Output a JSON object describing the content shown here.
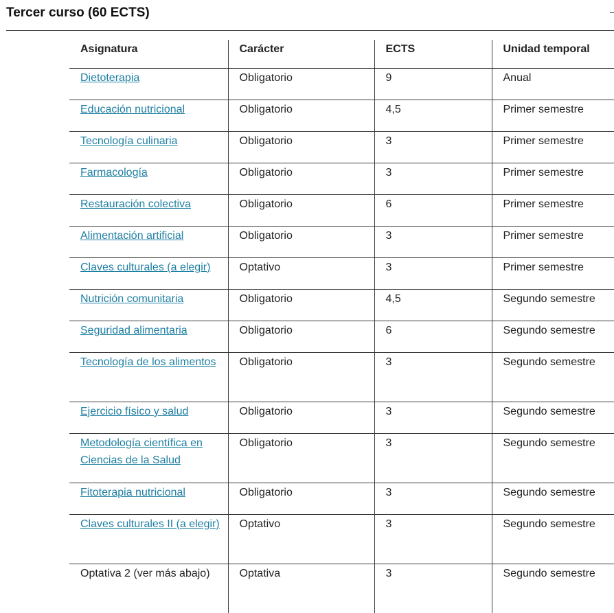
{
  "section": {
    "title": "Tercer curso (60 ECTS)"
  },
  "table": {
    "headers": [
      "Asignatura",
      "Carácter",
      "ECTS",
      "Unidad temporal"
    ],
    "rows": [
      {
        "subject": "Dietoterapia",
        "type": "Obligatorio",
        "ects": "9",
        "term": "Anual"
      },
      {
        "subject": "Educación nutricional",
        "type": "Obligatorio",
        "ects": "4,5",
        "term": "Primer semestre"
      },
      {
        "subject": "Tecnología culinaria",
        "type": "Obligatorio",
        "ects": "3",
        "term": "Primer semestre"
      },
      {
        "subject": "Farmacología",
        "type": "Obligatorio",
        "ects": "3",
        "term": "Primer semestre"
      },
      {
        "subject": "Restauración colectiva",
        "type": "Obligatorio",
        "ects": "6",
        "term": "Primer semestre"
      },
      {
        "subject": "Alimentación artificial",
        "type": "Obligatorio",
        "ects": "3",
        "term": "Primer semestre"
      },
      {
        "subject": "Claves culturales (a elegir)",
        "type": "Optativo",
        "ects": "3",
        "term": "Primer semestre"
      },
      {
        "subject": "Nutrición comunitaria",
        "type": "Obligatorio",
        "ects": "4,5",
        "term": "Segundo semestre"
      },
      {
        "subject": "Seguridad alimentaria",
        "type": "Obligatorio",
        "ects": "6",
        "term": "Segundo semestre"
      },
      {
        "subject": "Tecnología de los alimentos",
        "type": "Obligatorio",
        "ects": "3",
        "term": "Segundo semestre"
      },
      {
        "subject": "Ejercicio físico y salud",
        "type": "Obligatorio",
        "ects": "3",
        "term": "Segundo semestre"
      },
      {
        "subject": "Metodología científica en Ciencias de la Salud",
        "type": "Obligatorio",
        "ects": "3",
        "term": "Segundo semestre"
      },
      {
        "subject": "Fitoterapia nutricional",
        "type": "Obligatorio",
        "ects": "3",
        "term": "Segundo semestre"
      },
      {
        "subject": "Claves culturales II (a elegir)",
        "type": "Optativo",
        "ects": "3",
        "term": "Segundo semestre"
      },
      {
        "subject": "Optativa 2 (ver más abajo)",
        "type": "Optativa",
        "ects": "3",
        "term": "Segundo semestre"
      }
    ]
  },
  "colors": {
    "link": "#1e7fa3",
    "text": "#222222",
    "rule": "#3a3a3a"
  }
}
